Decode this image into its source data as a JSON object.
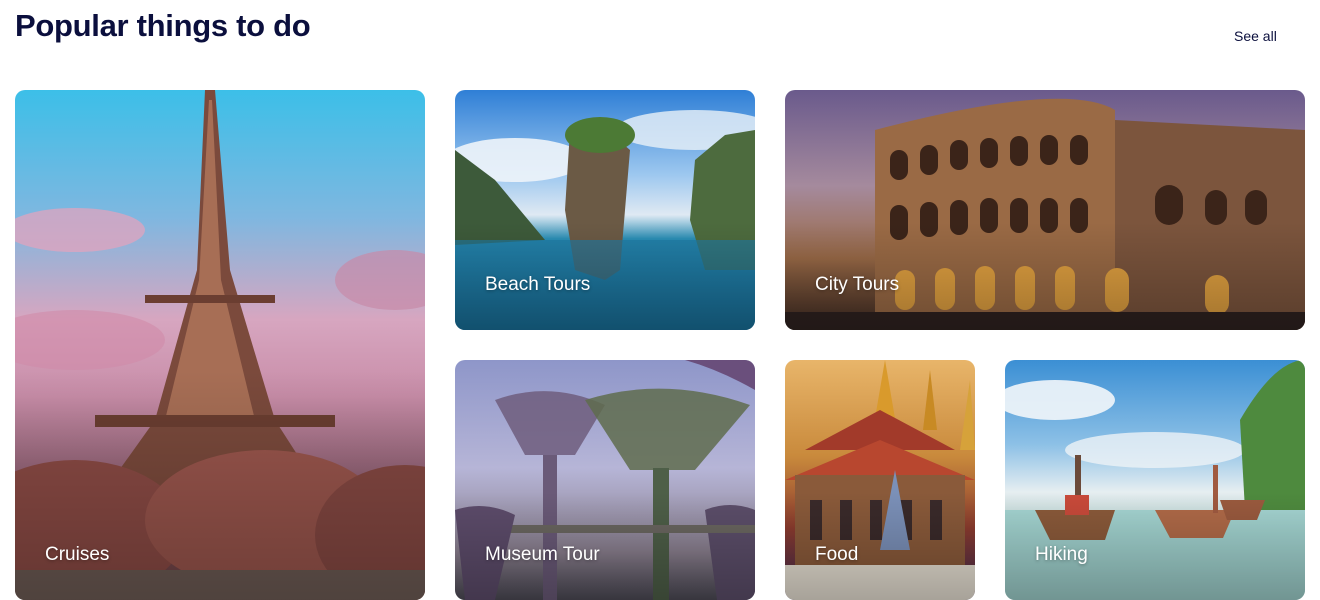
{
  "header": {
    "title": "Popular things to do",
    "see_all_label": "See all"
  },
  "cards": {
    "cruises": {
      "label": "Cruises",
      "image": "eiffel-tower-image"
    },
    "beach": {
      "label": "Beach Tours",
      "image": "rock-island-bay-image"
    },
    "city": {
      "label": "City Tours",
      "image": "colosseum-image"
    },
    "museum": {
      "label": "Museum Tour",
      "image": "supertree-grove-image"
    },
    "food": {
      "label": "Food",
      "image": "thai-temple-image"
    },
    "hiking": {
      "label": "Hiking",
      "image": "longtail-boats-beach-image"
    }
  },
  "colors": {
    "title": "#0b0f3d",
    "card_label": "#ffffff",
    "background": "#ffffff"
  }
}
